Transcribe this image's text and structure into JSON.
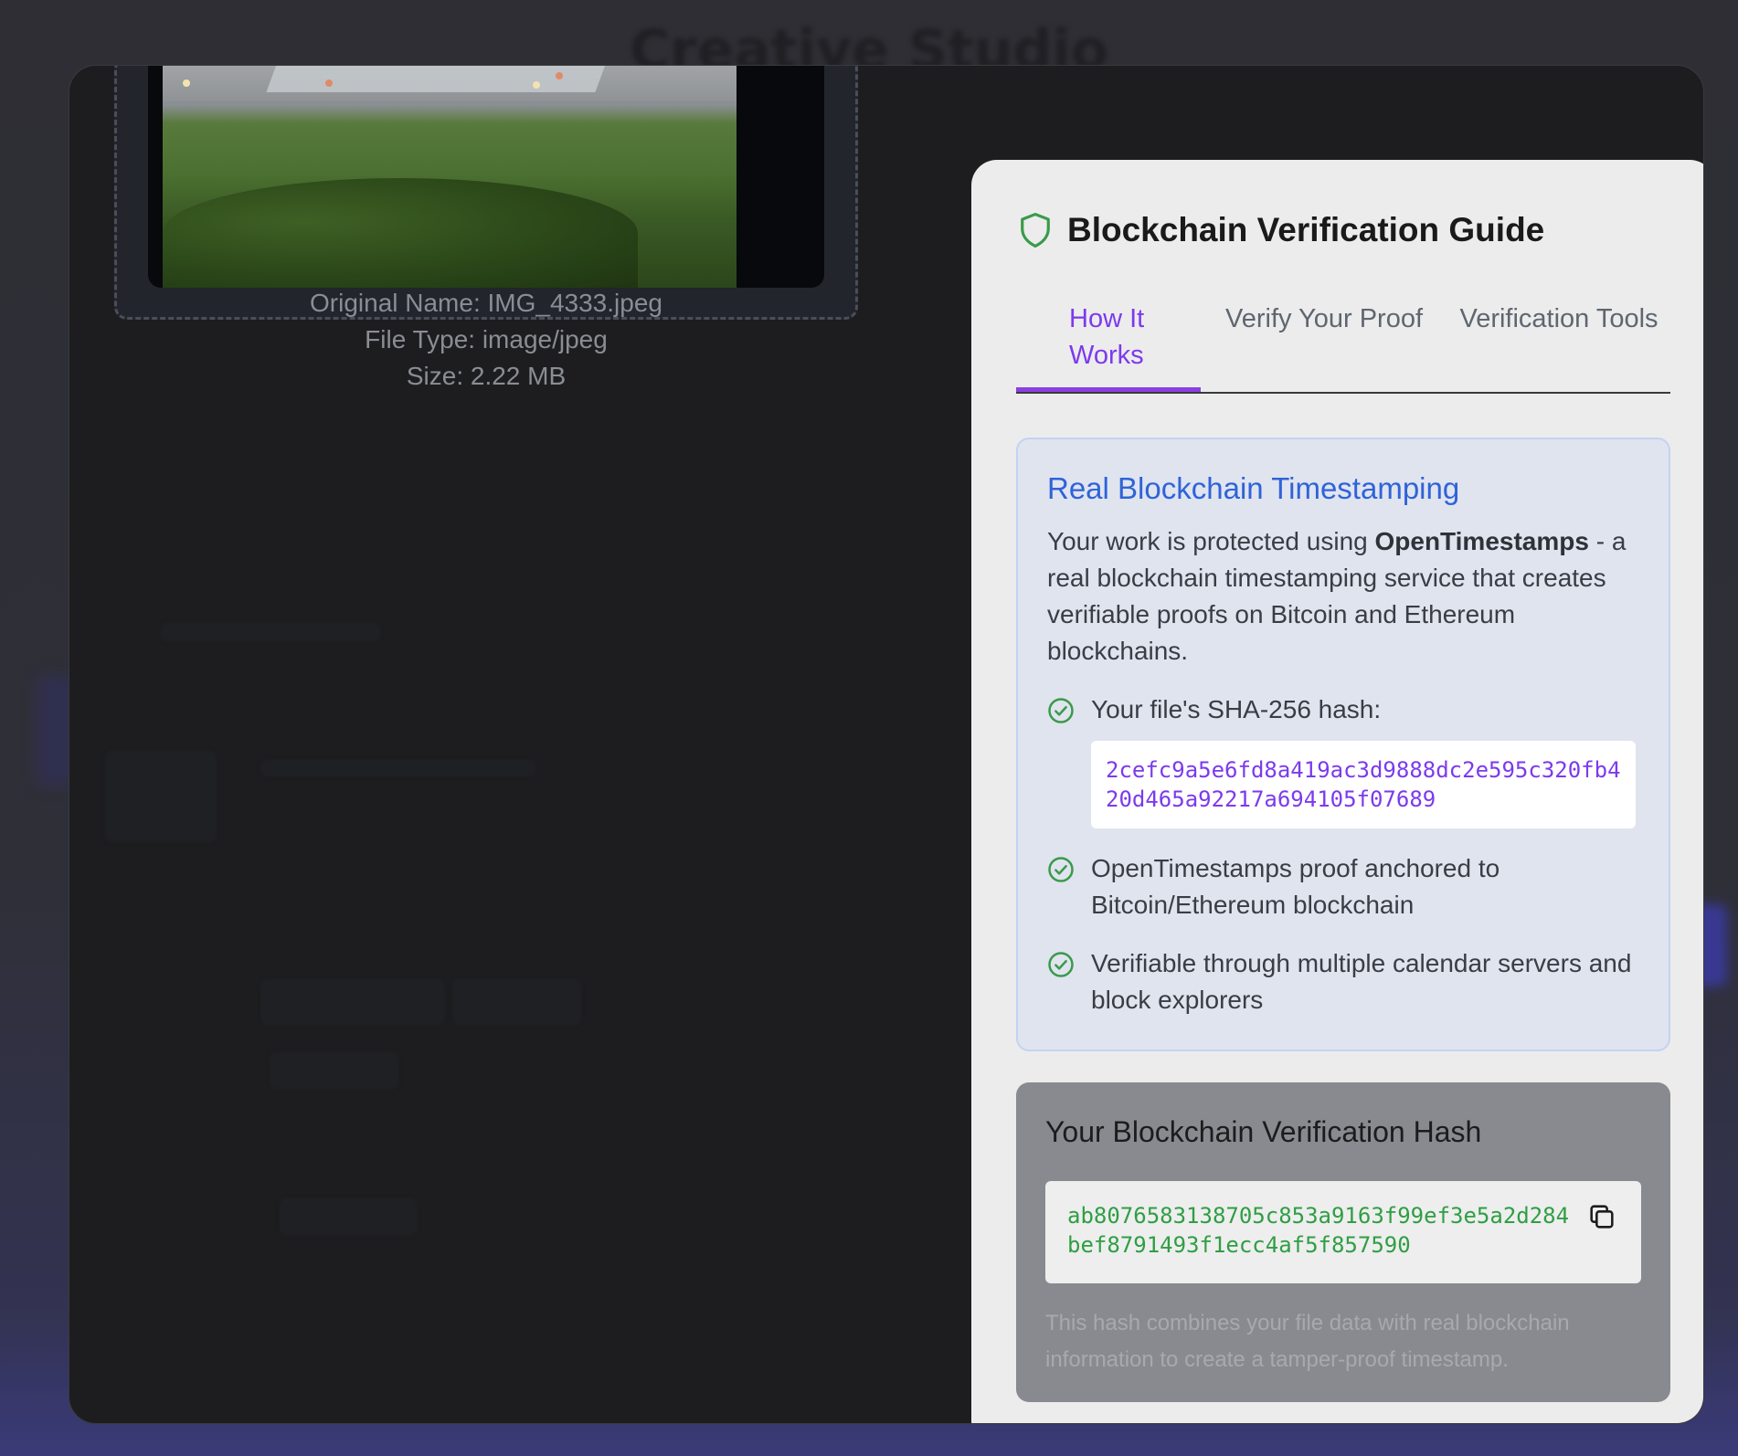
{
  "background": {
    "app_title": "Creative Studio"
  },
  "file_info": {
    "original_name": "Original Name: IMG_4333.jpeg",
    "file_type": "File Type: image/jpeg",
    "size": "Size: 2.22 MB"
  },
  "guide": {
    "title": "Blockchain Verification Guide",
    "tabs": [
      {
        "label": "How It Works",
        "active": true
      },
      {
        "label": "Verify Your Proof",
        "active": false
      },
      {
        "label": "Verification Tools",
        "active": false
      }
    ],
    "info": {
      "heading": "Real Blockchain Timestamping",
      "body_prefix": "Your work is protected using ",
      "body_strong": "OpenTimestamps",
      "body_suffix": " - a real blockchain timestamping service that creates verifiable proofs on Bitcoin and Ethereum blockchains.",
      "checks": [
        "Your file's SHA-256 hash:",
        "OpenTimestamps proof anchored to Bitcoin/Ethereum blockchain",
        "Verifiable through multiple calendar servers and block explorers"
      ],
      "sha256": "2cefc9a5e6fd8a419ac3d9888dc2e595c320fb420d465a92217a694105f07689"
    },
    "verification": {
      "heading": "Your Blockchain Verification Hash",
      "hash": "ab8076583138705c853a9163f99ef3e5a2d284bef8791493f1ecc4af5f857590",
      "note": "This hash combines your file data with real blockchain information to create a tamper-proof timestamp."
    }
  },
  "colors": {
    "accent_purple": "#7c3aed",
    "heading_blue": "#2f63d8",
    "success_green": "#2f9e44"
  },
  "icons": {
    "header": "shield-icon",
    "check": "check-circle-icon",
    "copy": "copy-icon"
  }
}
